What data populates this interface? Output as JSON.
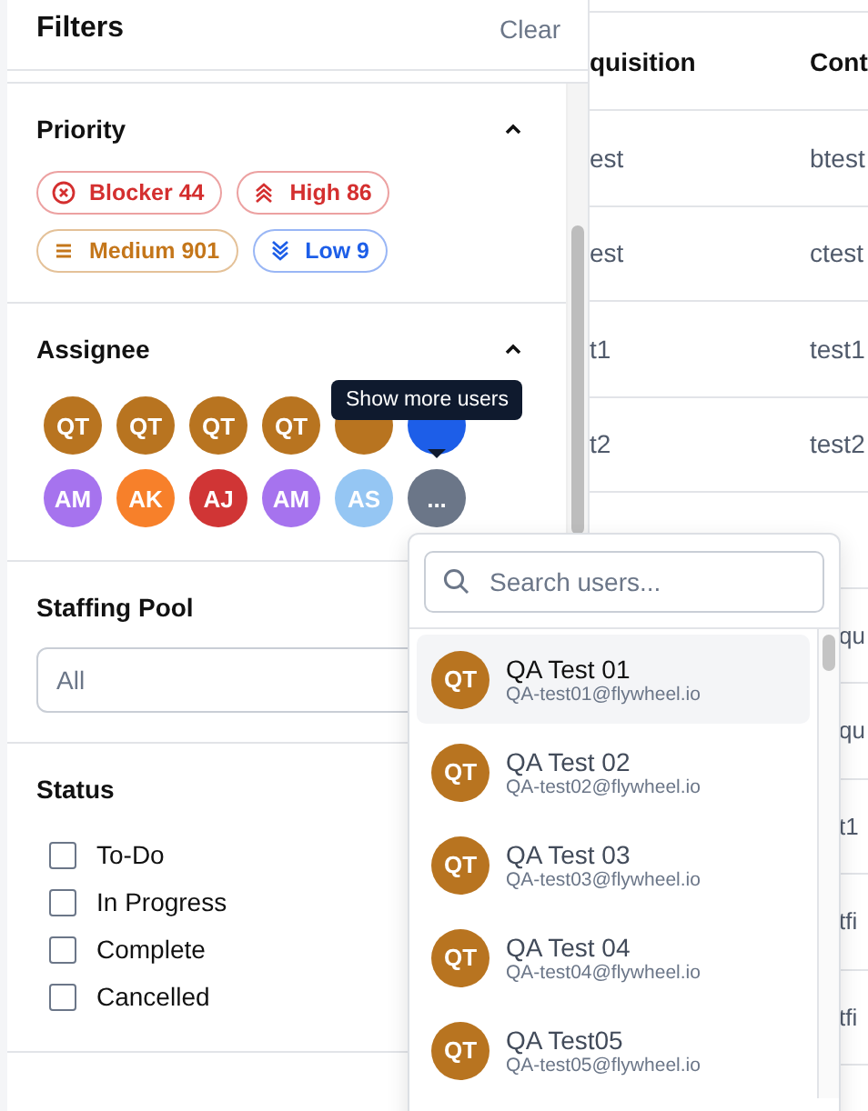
{
  "filters": {
    "title": "Filters",
    "clear": "Clear",
    "priority": {
      "title": "Priority",
      "expanded": true,
      "chips": [
        {
          "kind": "blocker",
          "label": "Blocker 44",
          "color": "#d42f2f"
        },
        {
          "kind": "high",
          "label": "High 86",
          "color": "#d42f2f"
        },
        {
          "kind": "medium",
          "label": "Medium 901",
          "color": "#c4761a"
        },
        {
          "kind": "low",
          "label": "Low 9",
          "color": "#1d5ee8"
        }
      ]
    },
    "assignee": {
      "title": "Assignee",
      "expanded": true,
      "avatars": [
        {
          "initials": "QT",
          "color": "#b87420"
        },
        {
          "initials": "QT",
          "color": "#b87420"
        },
        {
          "initials": "QT",
          "color": "#b87420"
        },
        {
          "initials": "QT",
          "color": "#b87420"
        },
        {
          "color": "#b87420"
        },
        {
          "color": "#1d5ee8"
        },
        {
          "initials": "AM",
          "color": "#a673ee"
        },
        {
          "initials": "AK",
          "color": "#f7802a"
        },
        {
          "initials": "AJ",
          "color": "#d03535"
        },
        {
          "initials": "AM",
          "color": "#a673ee"
        },
        {
          "initials": "AS",
          "color": "#95c6f3"
        }
      ],
      "more": "...",
      "tooltip": "Show more users"
    },
    "staffing_pool": {
      "title": "Staffing Pool",
      "placeholder": "All"
    },
    "status": {
      "title": "Status",
      "options": [
        {
          "label": "To-Do",
          "checked": false
        },
        {
          "label": "In Progress",
          "checked": false
        },
        {
          "label": "Complete",
          "checked": false
        },
        {
          "label": "Cancelled",
          "checked": false
        }
      ]
    }
  },
  "table": {
    "columns": [
      "quisition",
      "Cont"
    ],
    "rows": [
      [
        "est",
        "btest"
      ],
      [
        "est",
        "ctest"
      ],
      [
        "t1",
        "test1"
      ],
      [
        "t2",
        "test2"
      ],
      [
        "",
        ""
      ],
      [
        "",
        "qu"
      ],
      [
        "",
        "qu"
      ],
      [
        "",
        "t1"
      ],
      [
        "",
        "tfi"
      ],
      [
        "",
        "tfi"
      ]
    ]
  },
  "user_menu": {
    "search_placeholder": "Search users...",
    "users": [
      {
        "initials": "QT",
        "name": "QA Test 01",
        "email": "QA-test01@flywheel.io",
        "selected": true
      },
      {
        "initials": "QT",
        "name": "QA Test 02",
        "email": "QA-test02@flywheel.io",
        "selected": false
      },
      {
        "initials": "QT",
        "name": "QA Test 03",
        "email": "QA-test03@flywheel.io",
        "selected": false
      },
      {
        "initials": "QT",
        "name": "QA Test 04",
        "email": "QA-test04@flywheel.io",
        "selected": false
      },
      {
        "initials": "QT",
        "name": "QA Test05",
        "email": "QA-test05@flywheel.io",
        "selected": false
      }
    ]
  }
}
